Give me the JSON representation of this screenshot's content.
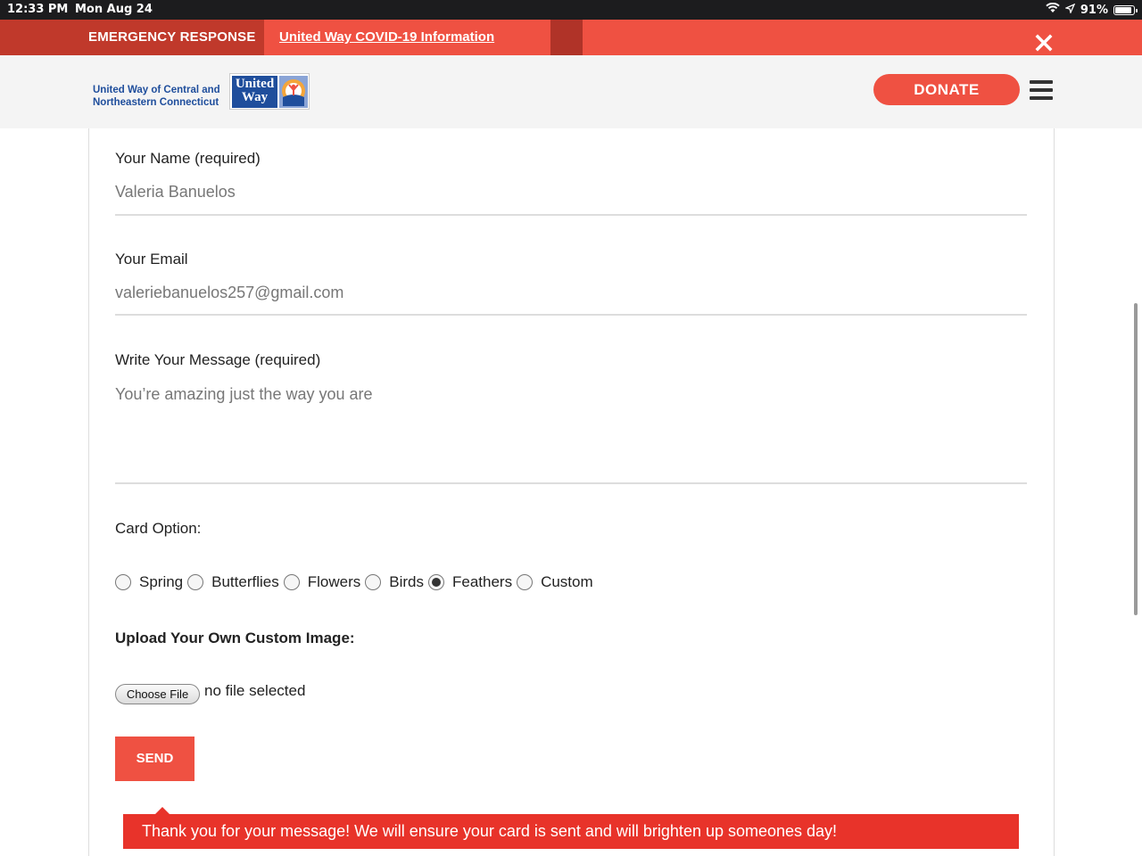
{
  "status_bar": {
    "time": "12:33 PM",
    "date": "Mon Aug 24",
    "battery": "91%",
    "battery_level": 0.91
  },
  "emergency_bar": {
    "label": "EMERGENCY RESPONSE",
    "link": "United Way COVID-19 Information"
  },
  "header": {
    "org_line1": "United Way of Central and",
    "org_line2": "Northeastern Connecticut",
    "logo_line1": "United",
    "logo_line2": "Way",
    "donate_label": "DONATE"
  },
  "form": {
    "name_label": "Your Name (required)",
    "name_value": "Valeria Banuelos",
    "email_label": "Your Email",
    "email_value": "valeriebanuelos257@gmail.com",
    "message_label": "Write Your Message (required)",
    "message_value": "You’re amazing just the way you are",
    "card_option_label": "Card Option:",
    "card_options": [
      "Spring",
      "Butterflies",
      "Flowers",
      "Birds",
      "Feathers",
      "Custom"
    ],
    "selected_option": "Feathers",
    "upload_label": "Upload Your Own Custom Image:",
    "choose_file_label": "Choose File",
    "no_file_text": "no file selected",
    "send_label": "SEND",
    "success_message": "Thank you for your message! We will ensure your card is sent and will brighten up someones day!"
  },
  "colors": {
    "brand_red": "#ef5142",
    "dark_red": "#c0392b",
    "brand_blue": "#1f4e9c"
  }
}
